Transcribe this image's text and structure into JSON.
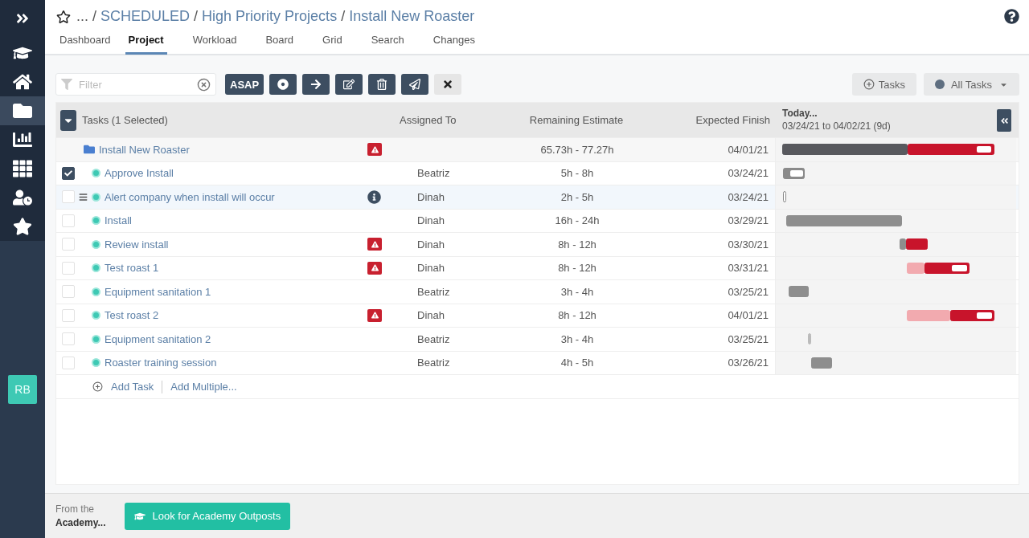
{
  "breadcrumb": [
    "...",
    "SCHEDULED",
    "High Priority Projects",
    "Install New Roaster"
  ],
  "breadcrumb_separator": "/",
  "tabs": [
    {
      "label": "Dashboard",
      "selected": false
    },
    {
      "label": "Project",
      "selected": true
    },
    {
      "label": "Workload",
      "selected": false
    },
    {
      "label": "Board",
      "selected": false
    },
    {
      "label": "Grid",
      "selected": false
    },
    {
      "label": "Search",
      "selected": false
    },
    {
      "label": "Changes",
      "selected": false
    }
  ],
  "filter": {
    "placeholder": "Filter"
  },
  "toolbar": [
    {
      "kind": "text",
      "label": "ASAP"
    },
    {
      "kind": "record"
    },
    {
      "kind": "arrow"
    },
    {
      "kind": "edit"
    },
    {
      "kind": "trash"
    },
    {
      "kind": "send"
    },
    {
      "kind": "close"
    }
  ],
  "add_tasks_button": "Tasks",
  "view_dropdown": "All Tasks",
  "table": {
    "columns": [
      "Tasks (1 Selected)",
      "Assigned To",
      "Remaining Estimate",
      "Expected Finish"
    ],
    "timeline": {
      "title": "Today...",
      "range": "03/24/21 to 04/02/21 (9d)"
    },
    "rows": [
      {
        "kind": "project",
        "name": "Install New Roaster",
        "warning": true,
        "info": false,
        "assigned": "",
        "estimate": "65.73h - 77.27h",
        "finish": "04/01/21",
        "highlighted": false
      },
      {
        "kind": "task",
        "name": "Approve Install",
        "checked": true,
        "warning": false,
        "info": false,
        "assigned": "Beatriz",
        "estimate": "5h - 8h",
        "finish": "03/24/21",
        "highlighted": false
      },
      {
        "kind": "task",
        "name": "Alert company when install will occur",
        "checked": false,
        "warning": false,
        "info": true,
        "assigned": "Dinah",
        "estimate": "2h - 5h",
        "finish": "03/24/21",
        "highlighted": true
      },
      {
        "kind": "task",
        "name": "Install",
        "checked": false,
        "warning": false,
        "info": false,
        "assigned": "Dinah",
        "estimate": "16h - 24h",
        "finish": "03/29/21",
        "highlighted": false
      },
      {
        "kind": "task",
        "name": "Review install",
        "checked": false,
        "warning": true,
        "info": false,
        "assigned": "Dinah",
        "estimate": "8h - 12h",
        "finish": "03/30/21",
        "highlighted": false
      },
      {
        "kind": "task",
        "name": "Test roast 1",
        "checked": false,
        "warning": true,
        "info": false,
        "assigned": "Dinah",
        "estimate": "8h - 12h",
        "finish": "03/31/21",
        "highlighted": false
      },
      {
        "kind": "task",
        "name": "Equipment sanitation 1",
        "checked": false,
        "warning": false,
        "info": false,
        "assigned": "Beatriz",
        "estimate": "3h - 4h",
        "finish": "03/25/21",
        "highlighted": false
      },
      {
        "kind": "task",
        "name": "Test roast 2",
        "checked": false,
        "warning": true,
        "info": false,
        "assigned": "Dinah",
        "estimate": "8h - 12h",
        "finish": "04/01/21",
        "highlighted": false
      },
      {
        "kind": "task",
        "name": "Equipment sanitation 2",
        "checked": false,
        "warning": false,
        "info": false,
        "assigned": "Beatriz",
        "estimate": "3h - 4h",
        "finish": "03/25/21",
        "highlighted": false
      },
      {
        "kind": "task",
        "name": "Roaster training session",
        "checked": false,
        "warning": false,
        "info": false,
        "assigned": "Beatriz",
        "estimate": "4h - 5h",
        "finish": "03/26/21",
        "highlighted": false
      }
    ]
  },
  "add_links": [
    "Add Task",
    "Add Multiple..."
  ],
  "footer": {
    "avatar": "RB",
    "promo_line1": "From the",
    "promo_line2": "Academy...",
    "button": "Look for Academy Outposts"
  }
}
